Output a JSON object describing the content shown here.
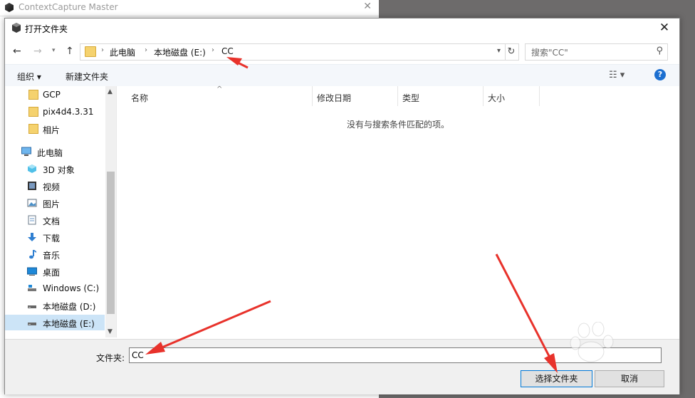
{
  "background_window": {
    "title": "ContextCapture Master"
  },
  "dialog": {
    "title": "打开文件夹",
    "close_glyph": "✕",
    "nav": {
      "back": "←",
      "forward": "→",
      "history": "▾",
      "up": "↑",
      "breadcrumbs": [
        "此电脑",
        "本地磁盘 (E:)",
        "CC"
      ],
      "refresh": "↻",
      "search_placeholder": "搜索\"CC\""
    },
    "toolbar": {
      "organize": "组织 ▾",
      "new_folder": "新建文件夹",
      "view": "☷ ▾",
      "help": "?"
    },
    "sidebar": {
      "items": [
        {
          "label": "GCP",
          "icon": "folder-icon"
        },
        {
          "label": "pix4d4.3.31",
          "icon": "folder-icon"
        },
        {
          "label": "相片",
          "icon": "folder-icon"
        },
        {
          "label": "此电脑",
          "icon": "computer-icon"
        },
        {
          "label": "3D 对象",
          "icon": "cube-icon"
        },
        {
          "label": "视频",
          "icon": "video-icon"
        },
        {
          "label": "图片",
          "icon": "picture-icon"
        },
        {
          "label": "文档",
          "icon": "document-icon"
        },
        {
          "label": "下载",
          "icon": "download-icon"
        },
        {
          "label": "音乐",
          "icon": "music-icon"
        },
        {
          "label": "桌面",
          "icon": "desktop-icon"
        },
        {
          "label": "Windows (C:)",
          "icon": "drive-icon"
        },
        {
          "label": "本地磁盘 (D:)",
          "icon": "drive-icon"
        },
        {
          "label": "本地磁盘 (E:)",
          "icon": "drive-icon",
          "selected": true
        }
      ]
    },
    "columns": [
      "名称",
      "修改日期",
      "类型",
      "大小"
    ],
    "empty_message": "没有与搜索条件匹配的项。",
    "footer": {
      "folder_label": "文件夹:",
      "folder_value": "CC",
      "select_button": "选择文件夹",
      "cancel_button": "取消"
    }
  },
  "colors": {
    "accent": "#0078d7",
    "selection": "#cce4f7",
    "annotation_arrow": "#e8322b"
  }
}
